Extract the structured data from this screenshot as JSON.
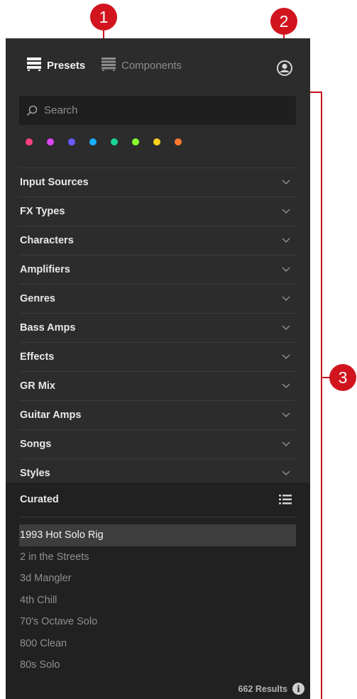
{
  "callouts": {
    "c1": "1",
    "c2": "2",
    "c3": "3"
  },
  "tabs": [
    {
      "label": "Presets",
      "active": true
    },
    {
      "label": "Components",
      "active": false
    }
  ],
  "search": {
    "placeholder": "Search"
  },
  "color_tags": [
    "#ff4081",
    "#d946ef",
    "#6a5cff",
    "#18b0ff",
    "#17d495",
    "#89ff2e",
    "#ffd21f",
    "#ff7a2e"
  ],
  "filters": [
    {
      "label": "Input Sources"
    },
    {
      "label": "FX Types"
    },
    {
      "label": "Characters"
    },
    {
      "label": "Amplifiers"
    },
    {
      "label": "Genres"
    },
    {
      "label": "Bass Amps"
    },
    {
      "label": "Effects"
    },
    {
      "label": "GR Mix"
    },
    {
      "label": "Guitar Amps"
    },
    {
      "label": "Songs"
    },
    {
      "label": "Styles"
    }
  ],
  "curated": {
    "label": "Curated"
  },
  "results": [
    {
      "label": "1993 Hot Solo Rig",
      "selected": true
    },
    {
      "label": "2 in the Streets"
    },
    {
      "label": "3d Mangler"
    },
    {
      "label": "4th Chill"
    },
    {
      "label": "70's Octave Solo"
    },
    {
      "label": "800 Clean"
    },
    {
      "label": "80s Solo"
    }
  ],
  "footer": {
    "results_count": "662 Results",
    "info_glyph": "i"
  },
  "colors": {
    "accent": "#d1141e",
    "panel": "#2c2c2c",
    "list_bg": "#212121"
  }
}
